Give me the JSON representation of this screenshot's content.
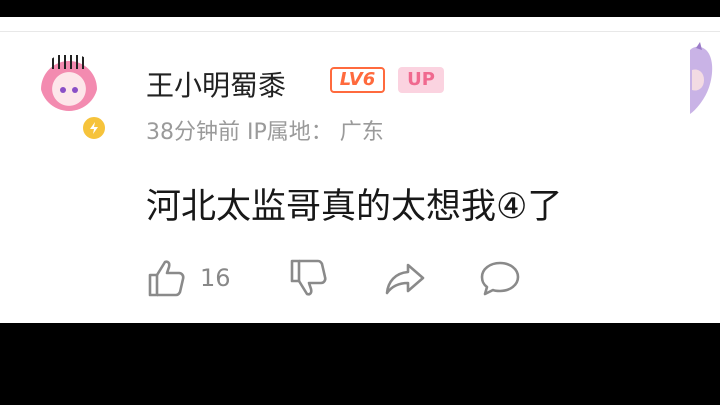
{
  "comment": {
    "username": "王小明蜀黍",
    "level_badge": "LV6",
    "up_badge": "UP",
    "time_text": "38分钟前",
    "ip_label": "IP属地：",
    "ip_location": "广东",
    "content": "河北太监哥真的太想我④了",
    "like_count": "16"
  },
  "icons": {
    "avatar": "anime-girl-avatar",
    "badge": "lightning-badge-icon",
    "like": "thumbs-up-icon",
    "dislike": "thumbs-down-icon",
    "share": "share-icon",
    "reply": "comment-icon"
  },
  "colors": {
    "level_badge": "#ff6a3d",
    "up_badge_text": "#f0698f",
    "up_badge_bg": "#fbd3e0",
    "meta_text": "#9a9a9a",
    "badge_yellow": "#f6c33b"
  }
}
